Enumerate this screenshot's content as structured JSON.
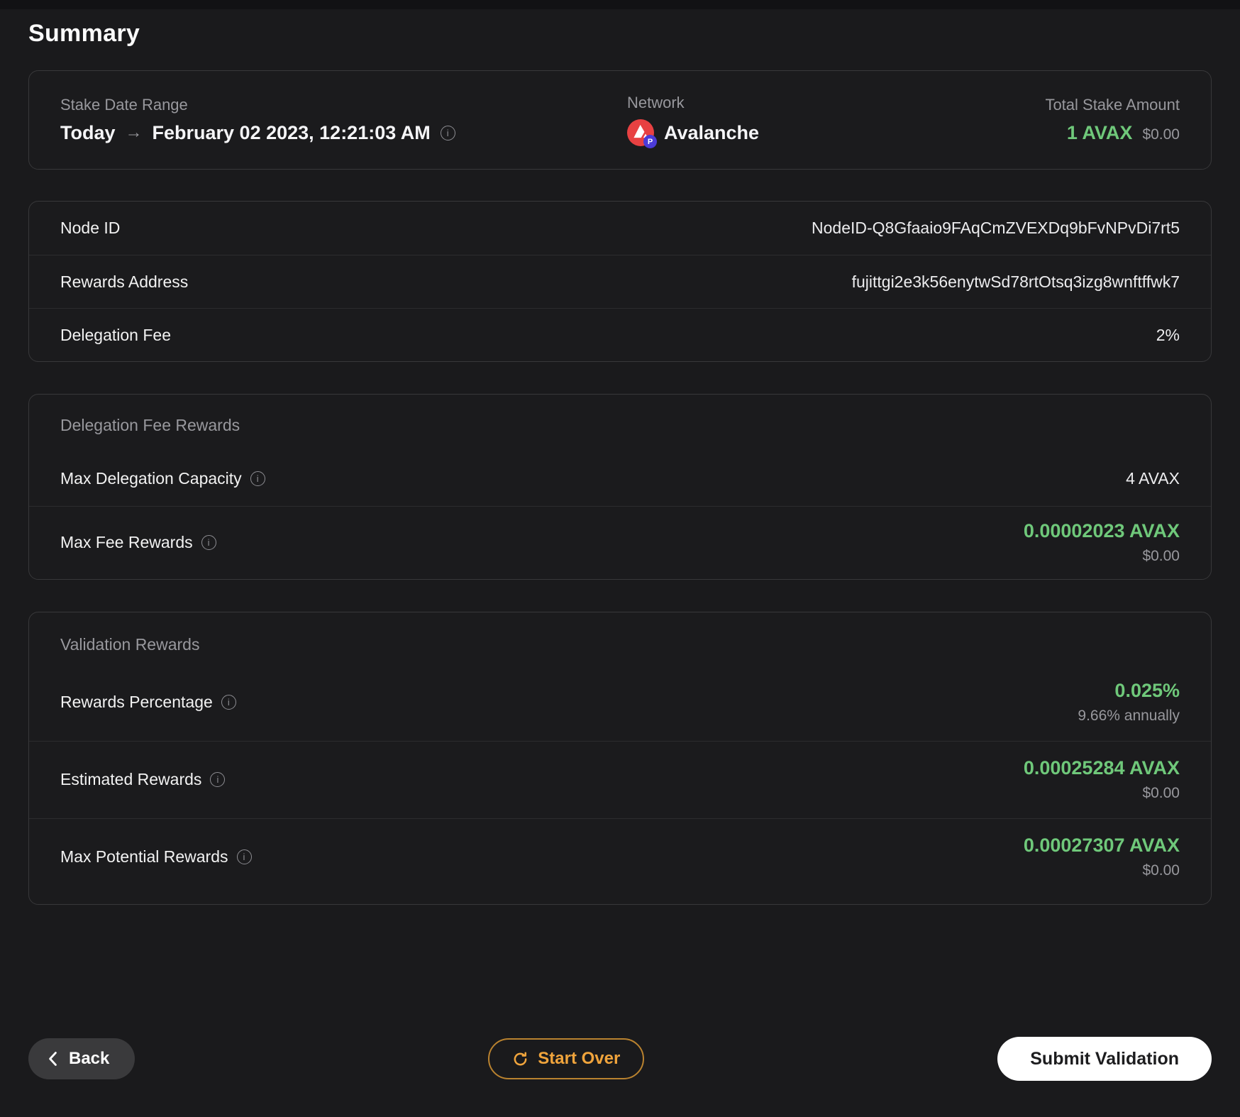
{
  "page": {
    "title": "Summary"
  },
  "icons": {
    "info": "i",
    "arrow_right": "→"
  },
  "summary_card": {
    "stake_date_range": {
      "label": "Stake Date Range",
      "from": "Today",
      "to": "February 02 2023, 12:21:03 AM"
    },
    "network": {
      "label": "Network",
      "name": "Avalanche",
      "badge_letter": "P"
    },
    "total_stake": {
      "label": "Total Stake Amount",
      "amount": "1 AVAX",
      "usd": "$0.00"
    }
  },
  "details_table": {
    "rows": [
      {
        "label": "Node ID",
        "value": "NodeID-Q8Gfaaio9FAqCmZVEXDq9bFvNPvDi7rt5"
      },
      {
        "label": "Rewards Address",
        "value": "fujittgi2e3k56enytwSd78rtOtsq3izg8wnftffwk7"
      },
      {
        "label": "Delegation Fee",
        "value": "2%"
      }
    ]
  },
  "delegation_fee_rewards": {
    "title": "Delegation Fee Rewards",
    "max_delegation_capacity": {
      "label": "Max Delegation Capacity",
      "value": "4 AVAX"
    },
    "max_fee_rewards": {
      "label": "Max Fee Rewards",
      "value": "0.00002023 AVAX",
      "usd": "$0.00"
    }
  },
  "validation_rewards": {
    "title": "Validation Rewards",
    "rewards_percentage": {
      "label": "Rewards Percentage",
      "value": "0.025%",
      "sub": "9.66% annually"
    },
    "estimated_rewards": {
      "label": "Estimated Rewards",
      "value": "0.00025284 AVAX",
      "usd": "$0.00"
    },
    "max_potential_rewards": {
      "label": "Max Potential Rewards",
      "value": "0.00027307 AVAX",
      "usd": "$0.00"
    }
  },
  "footer": {
    "back": "Back",
    "start_over": "Start Over",
    "submit": "Submit Validation"
  },
  "colors": {
    "accent_green": "#6fc87a",
    "accent_orange": "#f0a43c",
    "avalanche_red": "#e84142",
    "badge_purple": "#4b3bd8",
    "background": "#1a1a1c"
  }
}
